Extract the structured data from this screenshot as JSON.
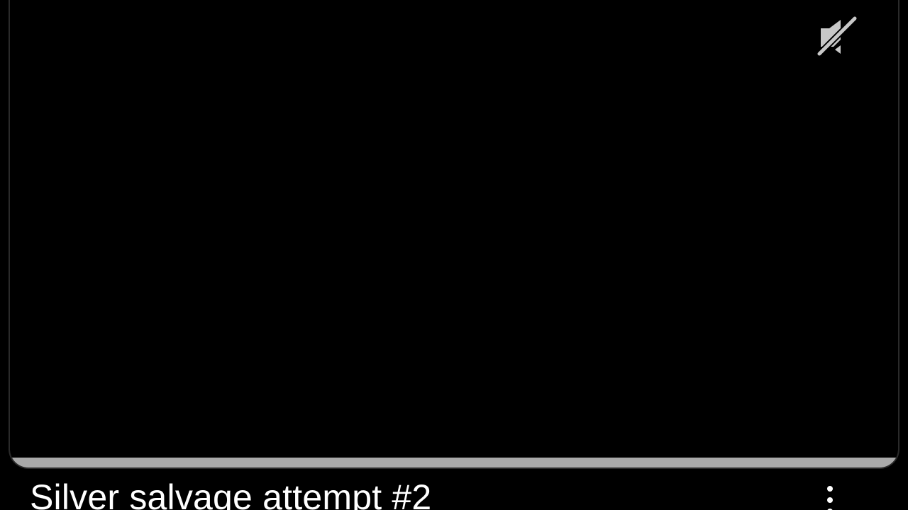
{
  "player": {
    "progress_fraction": 1.0,
    "mute_icon": "volume-muted-icon",
    "accent_color": "#a9a9a9",
    "icon_color": "#c8c8c8"
  },
  "video": {
    "title": "Silver salvage attempt #2",
    "more_icon": "more-vertical-icon"
  }
}
